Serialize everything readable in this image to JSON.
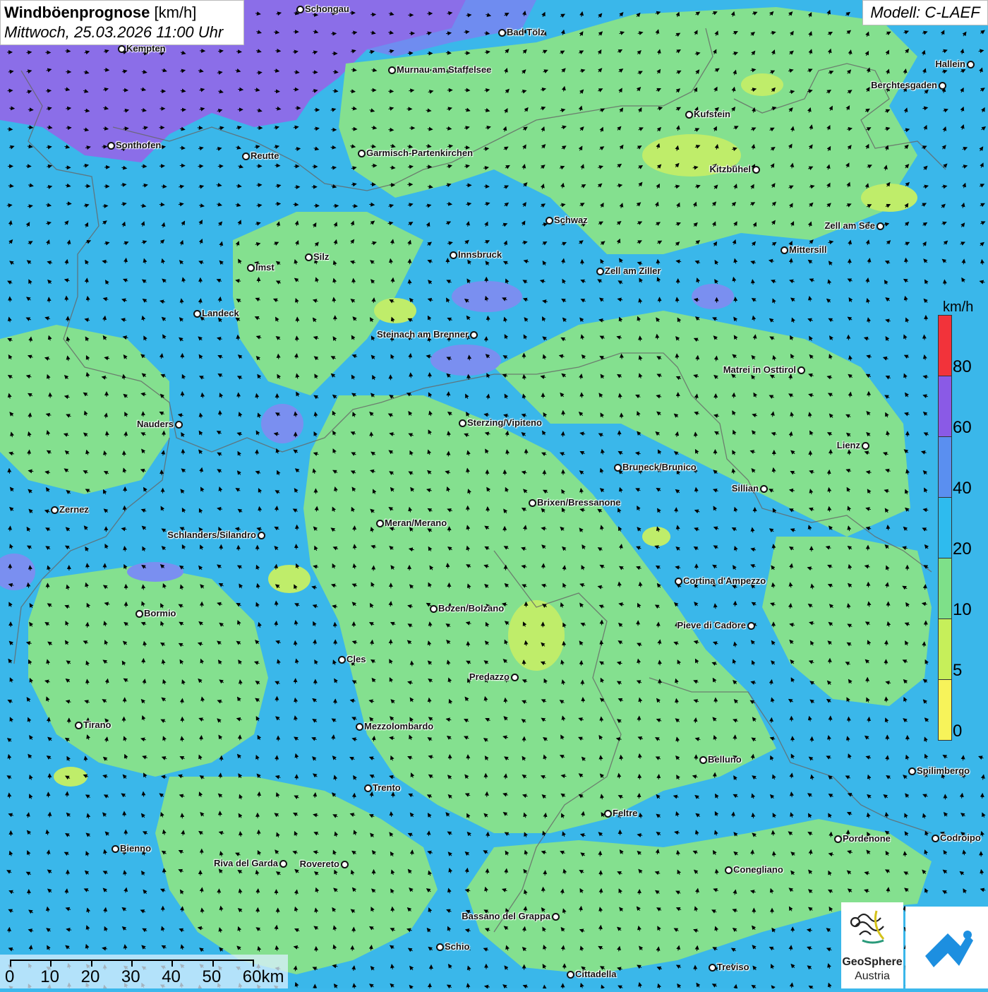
{
  "title": {
    "main": "Windböenprognose",
    "unit": "[km/h]",
    "date": "Mittwoch, 25.03.2026 11:00 Uhr"
  },
  "model": "Modell: C-LAEF",
  "legend": {
    "unit": "km/h",
    "labels": [
      "80",
      "60",
      "40",
      "20",
      "10",
      "5",
      "0"
    ],
    "colors": {
      "80": "#f2333a",
      "60": "#8a5ae6",
      "40": "#5a8ff0",
      "20": "#2ebbee",
      "10": "#7ee089",
      "5": "#c6ef5a",
      "0": "#f7f35a"
    }
  },
  "scale": {
    "labels": [
      "0",
      "10",
      "20",
      "30",
      "40",
      "50",
      "60km"
    ]
  },
  "cities": [
    {
      "name": "Schongau"
    },
    {
      "name": "Bad Tölz"
    },
    {
      "name": "Kempten"
    },
    {
      "name": "Murnau am Staffelsee"
    },
    {
      "name": "Hallein"
    },
    {
      "name": "Berchtesgaden"
    },
    {
      "name": "Kufstein"
    },
    {
      "name": "Sonthofen"
    },
    {
      "name": "Reutte"
    },
    {
      "name": "Garmisch-Partenkirchen"
    },
    {
      "name": "Kitzbühel"
    },
    {
      "name": "Schwaz"
    },
    {
      "name": "Zell am See"
    },
    {
      "name": "Mittersill"
    },
    {
      "name": "Innsbruck"
    },
    {
      "name": "Silz"
    },
    {
      "name": "Imst"
    },
    {
      "name": "Zell am Ziller"
    },
    {
      "name": "Landeck"
    },
    {
      "name": "Steinach am Brenner"
    },
    {
      "name": "Matrei in Osttirol"
    },
    {
      "name": "Nauders"
    },
    {
      "name": "Sterzing/Vipiteno"
    },
    {
      "name": "Lienz"
    },
    {
      "name": "Bruneck/Brunico"
    },
    {
      "name": "Sillian"
    },
    {
      "name": "Brixen/Bressanone"
    },
    {
      "name": "Zernez"
    },
    {
      "name": "Meran/Merano"
    },
    {
      "name": "Schlanders/Silandro"
    },
    {
      "name": "Cortina d'Ampezzo"
    },
    {
      "name": "Bozen/Bolzano"
    },
    {
      "name": "Bormio"
    },
    {
      "name": "Pieve di Cadore"
    },
    {
      "name": "Cles"
    },
    {
      "name": "Predazzo"
    },
    {
      "name": "Tirano"
    },
    {
      "name": "Mezzolombardo"
    },
    {
      "name": "Belluno"
    },
    {
      "name": "Spilimbergo"
    },
    {
      "name": "Trento"
    },
    {
      "name": "Feltre"
    },
    {
      "name": "Pordenone"
    },
    {
      "name": "Codroipo"
    },
    {
      "name": "Bienno"
    },
    {
      "name": "Riva del Garda"
    },
    {
      "name": "Rovereto"
    },
    {
      "name": "Conegliano"
    },
    {
      "name": "Bassano del Grappa"
    },
    {
      "name": "Schio"
    },
    {
      "name": "Treviso"
    },
    {
      "name": "Cittadella"
    }
  ],
  "logo": {
    "geo_line1": "GeoSphere",
    "geo_line2": "Austria"
  }
}
